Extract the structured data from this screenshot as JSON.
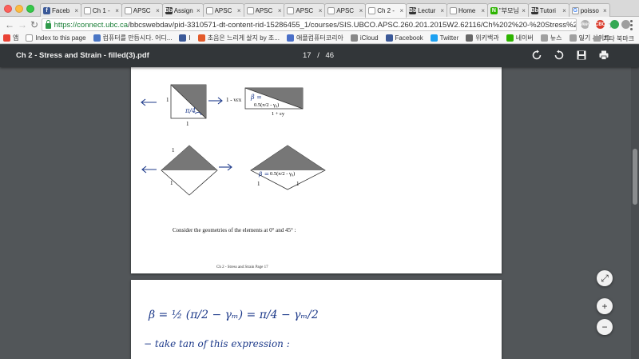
{
  "tabs": [
    {
      "label": "Faceb",
      "icon": "facebook-icon",
      "color": "#3b5998",
      "glyph": "f"
    },
    {
      "label": "Ch 1 -",
      "icon": "document-icon",
      "color": "#ffffff",
      "glyph": ""
    },
    {
      "label": "APSC",
      "icon": "document-icon",
      "color": "#ffffff",
      "glyph": ""
    },
    {
      "label": "Assign",
      "icon": "bb-icon",
      "color": "#333333",
      "glyph": "Bb"
    },
    {
      "label": "APSC",
      "icon": "document-icon",
      "color": "#ffffff",
      "glyph": ""
    },
    {
      "label": "APSC",
      "icon": "document-icon",
      "color": "#ffffff",
      "glyph": ""
    },
    {
      "label": "APSC",
      "icon": "document-icon",
      "color": "#ffffff",
      "glyph": ""
    },
    {
      "label": "APSC",
      "icon": "document-icon",
      "color": "#ffffff",
      "glyph": ""
    },
    {
      "label": "Ch 2 -",
      "icon": "document-icon",
      "color": "#ffffff",
      "glyph": ""
    },
    {
      "label": "Lectur",
      "icon": "bb-icon",
      "color": "#333333",
      "glyph": "Bb"
    },
    {
      "label": "Home",
      "icon": "document-icon",
      "color": "#ffffff",
      "glyph": ""
    },
    {
      "label": "\"부모님",
      "icon": "naver-icon",
      "color": "#2db400",
      "glyph": "N"
    },
    {
      "label": "Tutori",
      "icon": "bb-icon",
      "color": "#333333",
      "glyph": "Bb"
    },
    {
      "label": "poisso",
      "icon": "google-icon",
      "color": "#ffffff",
      "glyph": "G"
    }
  ],
  "active_tab_index": 8,
  "omnibox": {
    "host": "https://connect.ubc.ca",
    "path": "/bbcswebdav/pid-3310571-dt-content-rid-15286455_1/courses/SIS.UBCO.APSC.260.201.2015W2.62116/Ch%202%20-%20Stress%20and..."
  },
  "extensions": [
    {
      "label": "vkey",
      "color": "#b0b0b0",
      "text": "vkey"
    },
    {
      "label": "cbc",
      "color": "#d93a2b",
      "text": "CBC"
    },
    {
      "label": "green",
      "color": "#34a853",
      "text": ""
    },
    {
      "label": "gray",
      "color": "#9e9e9e",
      "text": ""
    }
  ],
  "bookmarks": [
    {
      "label": "앱",
      "icon": "apps-icon",
      "color": "#e94235"
    },
    {
      "label": "Index to this page",
      "icon": "page-icon",
      "color": "#ffffff"
    },
    {
      "label": "컴퓨터를 만듭시다. 어디...",
      "icon": "blog-icon",
      "color": "#4a76c5"
    },
    {
      "label": "I",
      "icon": "facebook-icon",
      "color": "#3b5998"
    },
    {
      "label": "초음은 느리게 살지 by 조...",
      "icon": "blogger-icon",
      "color": "#e35b2b"
    },
    {
      "label": "애플컴퓨터코리아",
      "icon": "s-icon",
      "color": "#4a6fc8"
    },
    {
      "label": "iCloud",
      "icon": "apple-icon",
      "color": "#888888"
    },
    {
      "label": "Facebook",
      "icon": "facebook-icon",
      "color": "#3b5998"
    },
    {
      "label": "Twitter",
      "icon": "twitter-icon",
      "color": "#1da1f2"
    },
    {
      "label": "위키백과",
      "icon": "wikipedia-icon",
      "color": "#666666"
    },
    {
      "label": "네이버",
      "icon": "naver-icon",
      "color": "#2db400"
    },
    {
      "label": "뉴스",
      "icon": "folder-icon",
      "color": "#a0a0a0"
    },
    {
      "label": "인기 사이트",
      "icon": "folder-icon",
      "color": "#a0a0a0"
    }
  ],
  "bookmarks_more": "»",
  "bookmarks_other": "기타 북마크",
  "pdf": {
    "title": "Ch 2 - Stress and Strain - filled(3).pdf",
    "page_current": "17",
    "page_sep": "/",
    "page_total": "46"
  },
  "page1": {
    "label_1a": "1",
    "label_pi4": "π/4",
    "label_1b": "1",
    "label_1vxy": "1 - vεx",
    "label_beta": "β =",
    "label_formula": "0.5(π/2 - γ₀)",
    "label_1ey": "1 + εy",
    "label_1c": "1",
    "label_1d": "1",
    "label_beta2": "β =",
    "label_formula2": "0.5(π/2 - γ₀)",
    "label_1e": "1",
    "label_1f": "1",
    "consider_text": "Consider the geometries of the elements at 0° and 45° :",
    "footer": "Ch 2 - Stress and Strain Page 17"
  },
  "page2": {
    "eq_lhs": "β = ½ (π/2 − γₘ) = π/4 − γₘ/2",
    "note": "− take  tan  of  this  expression :"
  },
  "zoom": {
    "fit": "⤢",
    "plus": "+",
    "minus": "−"
  }
}
